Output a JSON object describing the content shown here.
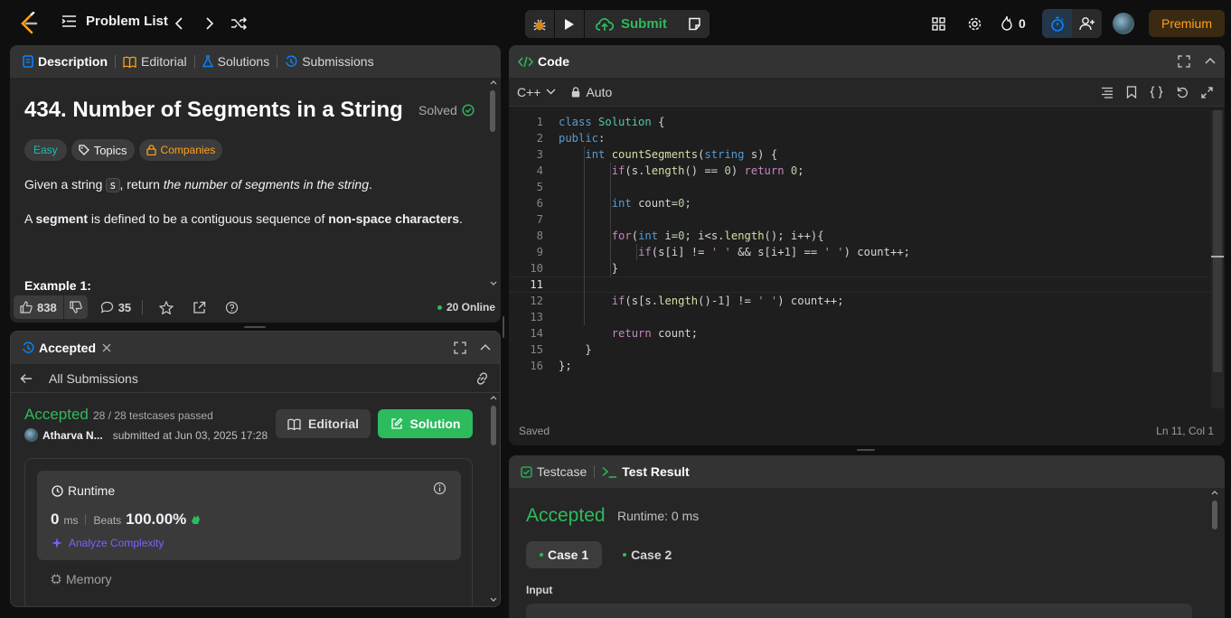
{
  "topbar": {
    "problem_list": "Problem List",
    "submit": "Submit",
    "streak": "0",
    "premium": "Premium"
  },
  "left": {
    "tabs": [
      "Description",
      "Editorial",
      "Solutions",
      "Submissions"
    ],
    "title": "434. Number of Segments in a String",
    "solved": "Solved",
    "tags": {
      "difficulty": "Easy",
      "topics": "Topics",
      "companies": "Companies"
    },
    "desc1": {
      "a": "Given a string ",
      "code": "s",
      "b": ", return ",
      "c": "the number of segments in the string",
      "d": "."
    },
    "desc2": {
      "a": "A ",
      "b": "segment",
      "c": " is defined to be a contiguous sequence of ",
      "d": "non-space characters",
      "e": "."
    },
    "example_heading": "Example 1:",
    "likes": "838",
    "comments": "35",
    "online": "20 Online"
  },
  "result": {
    "tab": "Accepted",
    "back": "All Submissions",
    "status": "Accepted",
    "testcases": "28 / 28 testcases passed",
    "user": "Atharva N...",
    "submitted": "submitted at Jun 03, 2025 17:28",
    "editorial_btn": "Editorial",
    "solution_btn": "Solution",
    "runtime_label": "Runtime",
    "runtime_value": "0",
    "runtime_unit": "ms",
    "beats_label": "Beats",
    "beats_value": "100.00%",
    "analyze": "Analyze Complexity",
    "memory_label": "Memory"
  },
  "code": {
    "title": "Code",
    "language": "C++",
    "mode": "Auto",
    "saved": "Saved",
    "cursor": "Ln 11, Col 1",
    "line_numbers": [
      "1",
      "2",
      "3",
      "4",
      "5",
      "6",
      "7",
      "8",
      "9",
      "10",
      "11",
      "12",
      "13",
      "14",
      "15",
      "16"
    ],
    "lines": [
      "class Solution {",
      "public:",
      "    int countSegments(string s) {",
      "        if(s.length() == 0) return 0;",
      "",
      "        int count=0;",
      "",
      "        for(int i=0; i<s.length(); i++){",
      "            if(s[i] != ' ' && s[i+1] == ' ') count++;",
      "        }",
      "",
      "        if(s[s.length()-1] != ' ') count++;",
      "",
      "        return count;",
      "    }",
      "};"
    ]
  },
  "testpanel": {
    "tab_testcase": "Testcase",
    "tab_result": "Test Result",
    "status": "Accepted",
    "runtime": "Runtime: 0 ms",
    "cases": [
      "Case 1",
      "Case 2"
    ],
    "input_label": "Input"
  },
  "colors": {
    "accent_green": "#2cbb5d",
    "premium": "#ffa116",
    "easy": "#1cbaba",
    "blue": "#0a84ff"
  }
}
